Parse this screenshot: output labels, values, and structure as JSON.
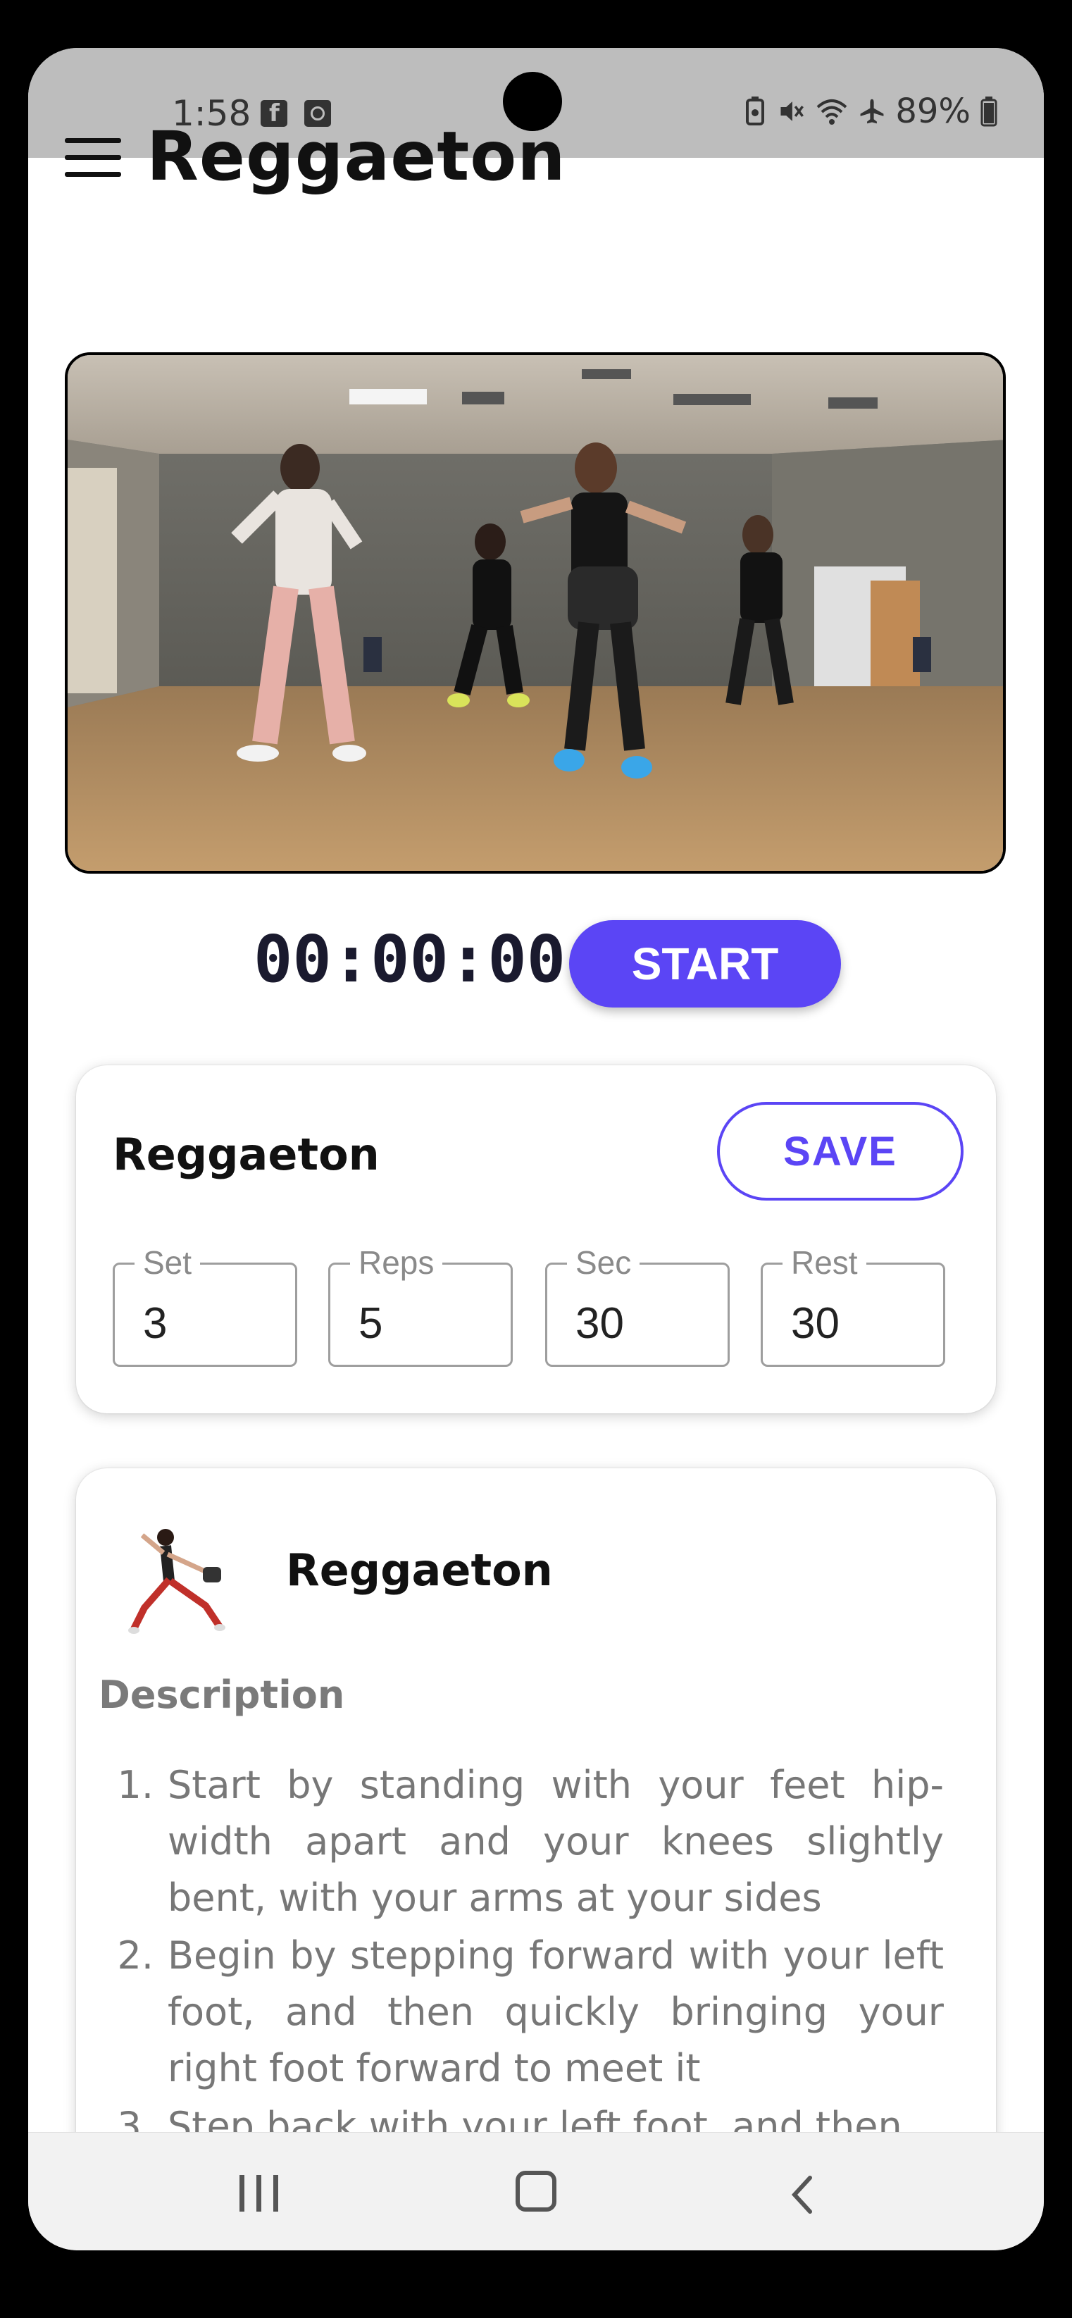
{
  "status_bar": {
    "time": "1:58",
    "left_icons": [
      "facebook-icon",
      "clock-notification-icon"
    ],
    "right_icons": [
      "battery-saver-icon",
      "mute-icon",
      "wifi-icon",
      "airplane-mode-icon"
    ],
    "battery": "89%"
  },
  "header": {
    "title": "Reggaeton",
    "menu_icon": "hamburger-menu-icon"
  },
  "video": {
    "description": "dance class video thumbnail"
  },
  "timer": {
    "display": "00:00:00",
    "start_label": "START"
  },
  "settings": {
    "title": "Reggaeton",
    "save_label": "SAVE",
    "fields": [
      {
        "label": "Set",
        "value": "3"
      },
      {
        "label": "Reps",
        "value": "5"
      },
      {
        "label": "Sec",
        "value": "30"
      },
      {
        "label": "Rest",
        "value": "30"
      }
    ]
  },
  "exercise": {
    "title": "Reggaeton",
    "description_heading": "Description",
    "steps": [
      {
        "num": "1.",
        "text": "Start by standing with your feet hip-width apart and your knees slightly bent, with your arms at your sides"
      },
      {
        "num": "2.",
        "text": "Begin by stepping forward with your left foot, and then quickly bringing your right foot forward to meet it"
      },
      {
        "num": "3.",
        "text": "Step back with your left foot, and then"
      }
    ]
  },
  "colors": {
    "accent": "#5b45f5",
    "status_bar_bg": "#bdbdbd",
    "timer_text": "#1a1a2e"
  }
}
